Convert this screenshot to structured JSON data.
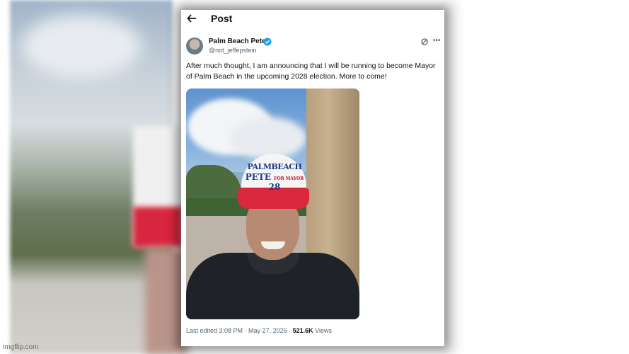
{
  "watermark": "imgflip.com",
  "header": {
    "title": "Post"
  },
  "post": {
    "author_name": "Palm Beach Pete",
    "handle": "@not_jeffepstein",
    "text": "After much thought, I am announcing that I will be running to become Mayor of Palm Beach in the upcoming 2028 election. More to come!",
    "image": {
      "hat_line1": "PALMBEACH",
      "hat_line2_a": "PETE",
      "hat_line2_small": "FOR MAYOR",
      "hat_line2_b": "28"
    },
    "meta": {
      "edited": "Last edited 3:08 PM · May 27, 2026 · ",
      "views_count": "521.6K",
      "views_label": " Views"
    }
  },
  "icons": {
    "back": "arrow-left-icon",
    "verified": "verified-badge-icon",
    "grok": "grok-icon",
    "more": "more-icon"
  },
  "colors": {
    "verified": "#1d9bf0",
    "hat_red": "#d9283c",
    "hat_blue": "#1d3a8a"
  }
}
